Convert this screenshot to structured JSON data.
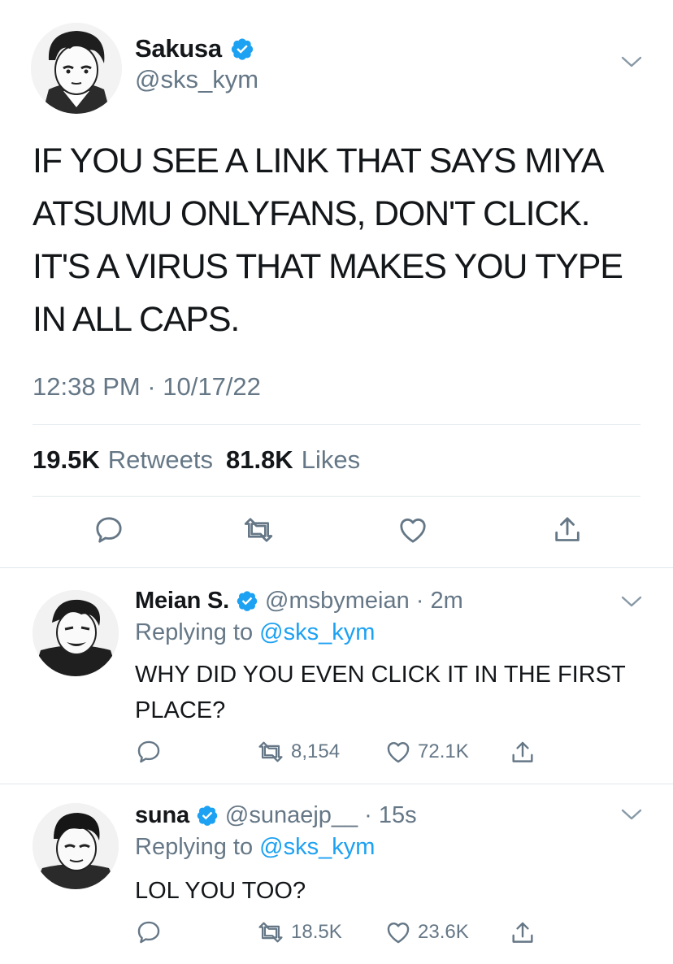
{
  "main_tweet": {
    "display_name": "Sakusa",
    "handle": "@sks_kym",
    "text": "IF YOU SEE A LINK THAT SAYS MIYA ATSUMU ONLYFANS, DON'T CLICK. IT'S A VIRUS THAT MAKES YOU TYPE IN ALL CAPS.",
    "timestamp": "12:38 PM · 10/17/22",
    "retweets_count": "19.5K",
    "retweets_label": "Retweets",
    "likes_count": "81.8K",
    "likes_label": "Likes"
  },
  "replies": [
    {
      "display_name": "Meian S.",
      "handle": "@msbymeian",
      "separator": "·",
      "time": "2m",
      "replying_prefix": "Replying to",
      "replying_to": "@sks_kym",
      "text": "WHY DID YOU EVEN CLICK IT IN THE FIRST PLACE?",
      "retweets": "8,154",
      "likes": "72.1K"
    },
    {
      "display_name": "suna",
      "handle": "@sunaejp__",
      "separator": "·",
      "time": "15s",
      "replying_prefix": "Replying to",
      "replying_to": "@sks_kym",
      "text": "LOL YOU TOO?",
      "retweets": "18.5K",
      "likes": "23.6K"
    }
  ],
  "colors": {
    "verified": "#1da1f2",
    "secondary_text": "#657786",
    "link": "#1da1f2",
    "divider": "#e1e8ed"
  }
}
